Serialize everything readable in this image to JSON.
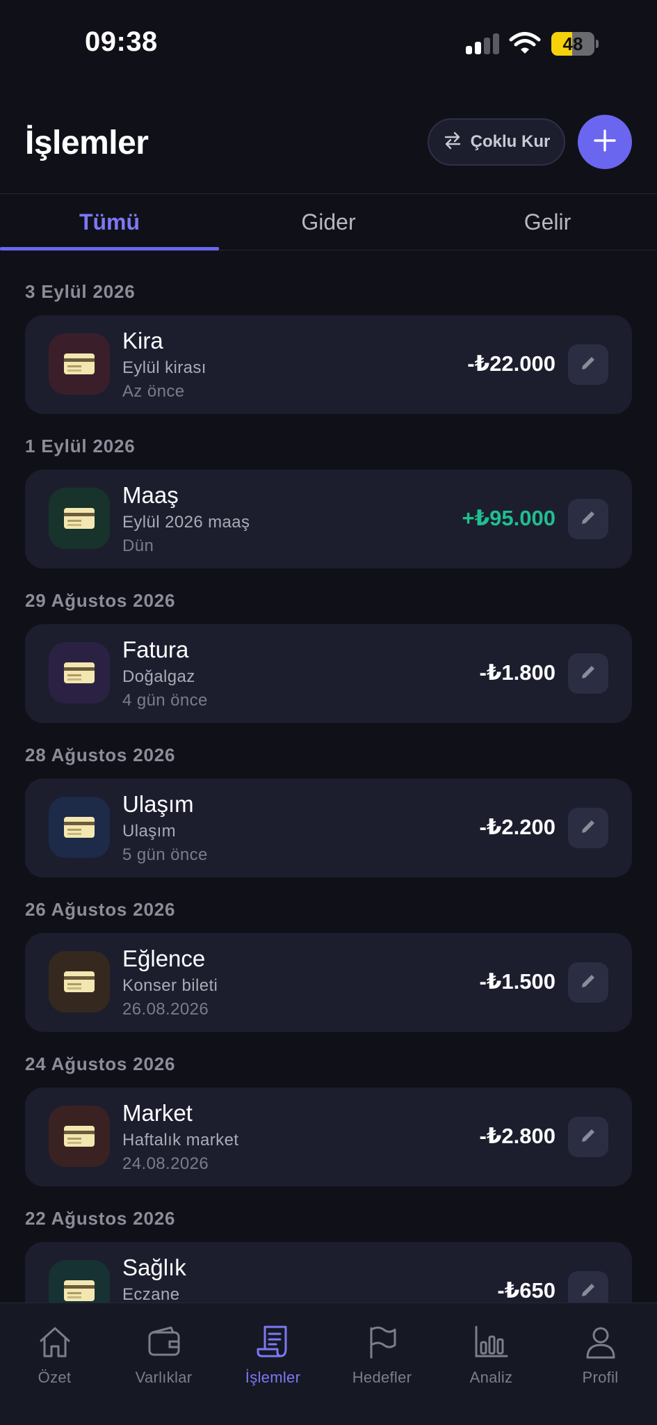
{
  "status_bar": {
    "time": "09:38",
    "battery": "48",
    "battery_level": 0.48
  },
  "header": {
    "title": "İşlemler",
    "multi_currency_label": "Çoklu Kur",
    "add_icon": "plus-icon"
  },
  "tabs": [
    {
      "label": "Tümü",
      "active": true
    },
    {
      "label": "Gider",
      "active": false
    },
    {
      "label": "Gelir",
      "active": false
    }
  ],
  "transactions": [
    {
      "date": "3 Eylül 2026",
      "title": "Kira",
      "desc": "Eylül kirası",
      "time": "Az önce",
      "amount": "-₺22.000",
      "type": "expense",
      "icon_bg": "#3a1f2a"
    },
    {
      "date": "1 Eylül 2026",
      "title": "Maaş",
      "desc": "Eylül 2026 maaş",
      "time": "Dün",
      "amount": "+₺95.000",
      "type": "income",
      "icon_bg": "#17332b"
    },
    {
      "date": "29 Ağustos 2026",
      "title": "Fatura",
      "desc": "Doğalgaz",
      "time": "4 gün önce",
      "amount": "-₺1.800",
      "type": "expense",
      "icon_bg": "#2b2243"
    },
    {
      "date": "28 Ağustos 2026",
      "title": "Ulaşım",
      "desc": "Ulaşım",
      "time": "5 gün önce",
      "amount": "-₺2.200",
      "type": "expense",
      "icon_bg": "#1d2a48"
    },
    {
      "date": "26 Ağustos 2026",
      "title": "Eğlence",
      "desc": "Konser bileti",
      "time": "26.08.2026",
      "amount": "-₺1.500",
      "type": "expense",
      "icon_bg": "#35291f"
    },
    {
      "date": "24 Ağustos 2026",
      "title": "Market",
      "desc": "Haftalık market",
      "time": "24.08.2026",
      "amount": "-₺2.800",
      "type": "expense",
      "icon_bg": "#3a2222"
    },
    {
      "date": "22 Ağustos 2026",
      "title": "Sağlık",
      "desc": "Eczane",
      "time": "",
      "amount": "-₺650",
      "type": "expense",
      "icon_bg": "#163232"
    }
  ],
  "bottom_nav": [
    {
      "label": "Özet",
      "icon": "home-icon",
      "active": false
    },
    {
      "label": "Varlıklar",
      "icon": "wallet-icon",
      "active": false
    },
    {
      "label": "İşlemler",
      "icon": "receipt-icon",
      "active": true
    },
    {
      "label": "Hedefler",
      "icon": "flag-icon",
      "active": false
    },
    {
      "label": "Analiz",
      "icon": "bar-chart-icon",
      "active": false
    },
    {
      "label": "Profil",
      "icon": "user-icon",
      "active": false
    }
  ],
  "colors": {
    "background": "#101118",
    "card": "#1c1e2e",
    "accent": "#6a66f0",
    "income": "#1fbf8f"
  }
}
